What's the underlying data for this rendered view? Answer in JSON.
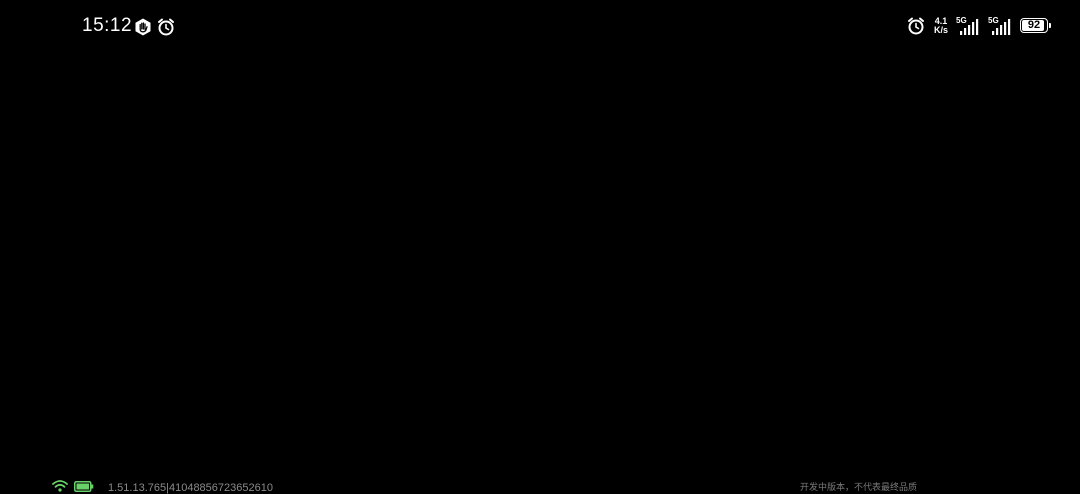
{
  "status_bar": {
    "time": "15:12",
    "left_icons": [
      "hand-gesture-icon",
      "alarm-clock-icon"
    ],
    "right_icons": [
      "alarm-clock-icon",
      "network-speed",
      "signal-5g-sim1",
      "signal-5g-sim2",
      "battery-icon"
    ],
    "net_speed_value": "4.1",
    "net_speed_unit": "K/s",
    "sim1_network": "5G",
    "sim2_network": "5G",
    "battery_percent": "92",
    "battery_level": 0.92
  },
  "bottom_bar": {
    "debug_info": "1.51.13.765|41048856723652610",
    "disclaimer": "开发中版本，不代表最终品质",
    "wifi_color": "#6ad16a",
    "battery_color": "#6ad16a"
  },
  "colors": {
    "background": "#000000",
    "status_text": "#ffffff",
    "debug_text": "#8a8a8a"
  }
}
